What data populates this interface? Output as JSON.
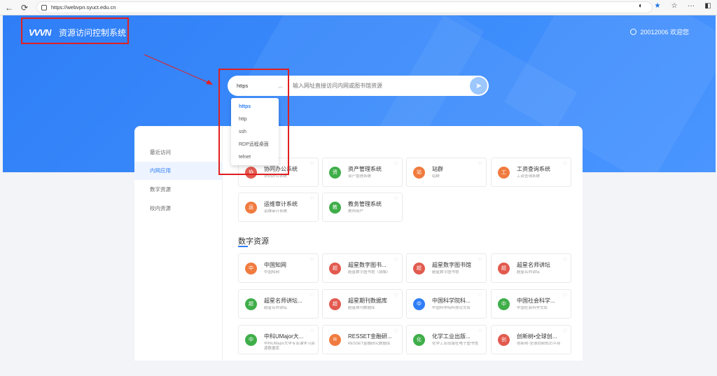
{
  "browser": {
    "url": "https://webvpn.syuct.edu.cn",
    "back_icon": "←",
    "reload_icon": "⟳",
    "more_icon": "···"
  },
  "header": {
    "logo_text": "VVVN",
    "site_title": "资源访问控制系统",
    "user_label": "20012006 欢迎您"
  },
  "search": {
    "protocol": "https",
    "placeholder": "输入网址直接访问内网或图书馆资源"
  },
  "protocol_options": [
    "https",
    "http",
    "ssh",
    "RDP远程桌面",
    "telnet"
  ],
  "sidebar": {
    "items": [
      {
        "label": "最近访问"
      },
      {
        "label": "内网应用"
      },
      {
        "label": "数字资源"
      },
      {
        "label": "校内资源"
      }
    ]
  },
  "intranet_apps": [
    {
      "badge": "协",
      "title": "协同办公系统",
      "sub": "协同办公系统",
      "color": "#e25a4f"
    },
    {
      "badge": "资",
      "title": "资产管理系统",
      "sub": "资产管理系统",
      "color": "#3fae49"
    },
    {
      "badge": "站",
      "title": "站群",
      "sub": "站群",
      "color": "#f07b3f"
    },
    {
      "badge": "工",
      "title": "工资查询系统",
      "sub": "工资查询系统",
      "color": "#f07b3f"
    },
    {
      "badge": "运",
      "title": "运维审计系统",
      "sub": "运维审计系统",
      "color": "#f07b3f"
    },
    {
      "badge": "教",
      "title": "教务管理系统",
      "sub": "教师用户",
      "color": "#3fae49"
    }
  ],
  "digital_section_title": "数字资源",
  "digital_resources": [
    {
      "badge": "中",
      "title": "中国知网",
      "sub": "中国知网",
      "color": "#f07b3f"
    },
    {
      "badge": "超",
      "title": "超星数字图书...",
      "sub": "超星数字图书馆（镜像）",
      "color": "#e25a4f"
    },
    {
      "badge": "超",
      "title": "超星数字图书馆",
      "sub": "超星数字图书馆",
      "color": "#e25a4f"
    },
    {
      "badge": "超",
      "title": "超星名师讲坛",
      "sub": "超星名师讲坛",
      "color": "#e25a4f"
    },
    {
      "badge": "超",
      "title": "超星名师讲坛...",
      "sub": "超星名师讲坛",
      "color": "#3fae49"
    },
    {
      "badge": "超",
      "title": "超星期刊数据库",
      "sub": "超星期刊数据库",
      "color": "#e25a4f"
    },
    {
      "badge": "中",
      "title": "中国科学院科...",
      "sub": "中国科学院科技论文库",
      "color": "#2f7ef7"
    },
    {
      "badge": "中",
      "title": "中国社会科学...",
      "sub": "中国社会科学文库",
      "color": "#3fae49"
    },
    {
      "badge": "中",
      "title": "中科UMajor大...",
      "sub": "中科UMajor大学专业课学习资源数据库",
      "color": "#3fae49"
    },
    {
      "badge": "R",
      "title": "RESSET金融研...",
      "sub": "RESSET金融研究数据库",
      "color": "#f07b3f"
    },
    {
      "badge": "化",
      "title": "化学工业出版...",
      "sub": "化学工业出版社电子图书馆",
      "color": "#3fae49"
    },
    {
      "badge": "创",
      "title": "创新树•全球创...",
      "sub": "创新树-全球创新知识平台",
      "color": "#e25a4f"
    }
  ]
}
